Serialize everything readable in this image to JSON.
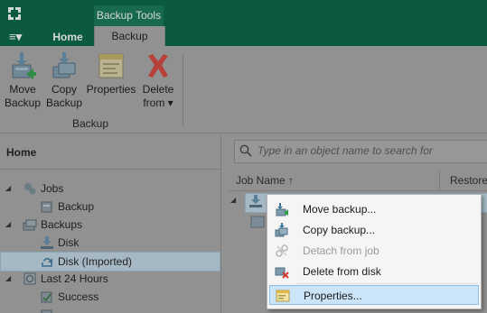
{
  "header": {
    "context_tab": "Backup Tools",
    "menu_button": "≡▾",
    "tabs": [
      "Home",
      "Backup"
    ]
  },
  "ribbon": {
    "buttons": [
      {
        "label": "Move\nBackup",
        "icon": "move-backup-icon"
      },
      {
        "label": "Copy\nBackup",
        "icon": "copy-backup-icon"
      },
      {
        "label": "Properties",
        "icon": "properties-icon"
      },
      {
        "label": "Delete\nfrom ▾",
        "icon": "delete-icon"
      }
    ],
    "group_label": "Backup"
  },
  "nav": {
    "title": "Home",
    "tree": [
      {
        "label": "Jobs",
        "icon": "jobs-icon",
        "expander": "◢"
      },
      {
        "label": "Backup",
        "icon": "backup-job-icon",
        "expander": ""
      },
      {
        "label": "Backups",
        "icon": "backups-icon",
        "expander": "◢"
      },
      {
        "label": "Disk",
        "icon": "disk-icon",
        "expander": ""
      },
      {
        "label": "Disk (Imported)",
        "icon": "disk-imported-icon",
        "expander": ""
      },
      {
        "label": "Last 24 Hours",
        "icon": "last-24-hours-icon",
        "expander": "◢"
      },
      {
        "label": "Success",
        "icon": "success-icon",
        "expander": ""
      }
    ]
  },
  "main": {
    "search_placeholder": "Type in an object name to search for",
    "columns": [
      "Job Name ↑",
      "Restore"
    ]
  },
  "context_menu": {
    "items": [
      {
        "label": "Move backup...",
        "icon": "move-backup-icon",
        "enabled": true
      },
      {
        "label": "Copy backup...",
        "icon": "copy-backup-icon",
        "enabled": true
      },
      {
        "label": "Detach from job",
        "icon": "detach-icon",
        "enabled": false
      },
      {
        "label": "Delete from disk",
        "icon": "delete-from-disk-icon",
        "enabled": true
      },
      {
        "label": "Properties...",
        "icon": "properties-icon",
        "enabled": true
      }
    ]
  },
  "colors": {
    "brand_green": "#0b5a3e",
    "selection": "#cce4f7"
  }
}
